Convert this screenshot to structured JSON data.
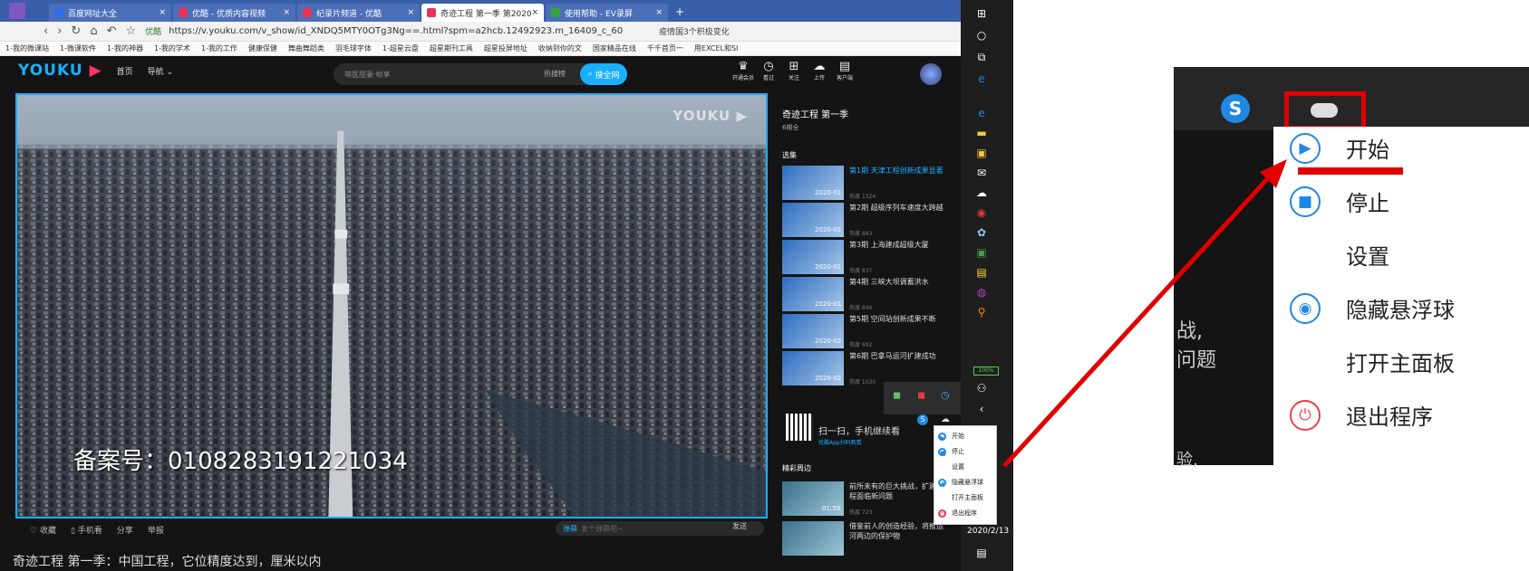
{
  "browser": {
    "tabs": [
      {
        "label": "百度网址大全",
        "color": "#2e6cf0",
        "active": false
      },
      {
        "label": "优酷 - 优质内容视频",
        "color": "#e8325a",
        "active": false
      },
      {
        "label": "纪录片频道 - 优酷",
        "color": "#e8325a",
        "active": false
      },
      {
        "label": "奇迹工程 第一季 第2020",
        "color": "#e8325a",
        "active": true
      },
      {
        "label": "使用帮助 - EV录屏",
        "color": "#37a637",
        "active": false
      }
    ],
    "new_tab": "+",
    "url": "https://v.youku.com/v_show/id_XNDQ5MTY0OTg3Ng==.html?spm=a2hcb.12492923.m_16409_c_60",
    "url_security": "优酷",
    "search_hint": "疫情国3个积极变化",
    "bookmarks": [
      "1-我的微课站",
      "1-微课软件",
      "1-我的神器",
      "1-我的学术",
      "1-我的工作",
      "健康保健",
      "舞曲舞蹈类",
      "羽毛球字体",
      "1-超星云盘",
      "超星期刊工具",
      "超星投屏地址",
      "收纳到你的文",
      "国家精品在线",
      "千千首页一",
      "用EXCEL和SI"
    ]
  },
  "youku": {
    "logo": "YOUKU",
    "nav_home": "首页",
    "nav_menu": "导航",
    "search_placeholder": "萌医甜妻·帧享",
    "hot_search": "热搜榜",
    "search_button": "搜全网",
    "header_icons": [
      {
        "label": "开通会员",
        "icon": "crown-icon",
        "glyph": "♛"
      },
      {
        "label": "看过",
        "icon": "history-icon",
        "glyph": "◷"
      },
      {
        "label": "关注",
        "icon": "follow-icon",
        "glyph": "⊞"
      },
      {
        "label": "上传",
        "icon": "upload-icon",
        "glyph": "☁"
      },
      {
        "label": "客户端",
        "icon": "client-icon",
        "glyph": "▤"
      }
    ],
    "video_watermark": "YOUKU",
    "video_caption": "备案号：0108283191221034",
    "controls": [
      "收藏",
      "手机看",
      "分享",
      "举报"
    ],
    "danmu_placeholder": "发个弹幕吧~",
    "danmu_label": "弹幕",
    "danmu_send": "发送",
    "bottom_title": "奇迹工程 第一季：中国工程，它位精度达到，厘米以内"
  },
  "right_panel": {
    "title": "奇迹工程 第一季",
    "subtitle": "6期全",
    "section": "选集",
    "episodes": [
      {
        "title": "第1期 天津工程创新成果显著",
        "date": "2020-01",
        "hot": "热度 1324",
        "active": true
      },
      {
        "title": "第2期 超级序列车速度大跨越",
        "date": "2020-01",
        "hot": "热度 883",
        "active": false
      },
      {
        "title": "第3期 上海建成超级大厦",
        "date": "2020-01",
        "hot": "热度 837",
        "active": false
      },
      {
        "title": "第4期 三峡大坝调蓄洪水",
        "date": "2020-01",
        "hot": "热度 846",
        "active": false
      },
      {
        "title": "第5期 空间站创新成果不断",
        "date": "2020-02",
        "hot": "热度 692",
        "active": false
      },
      {
        "title": "第6期 巴拿马运河扩建成功",
        "date": "2020-02",
        "hot": "热度 1030",
        "active": false
      }
    ],
    "qr_text": "扫一扫，手机继续看",
    "qr_sub": "优酷App扫码观看",
    "more_section": "精彩周边",
    "more_items": [
      {
        "title": "前所未有的巨大挑战，扩建工程面临新问题",
        "duration": "01:59",
        "hot": "热度 723"
      },
      {
        "title": "借鉴前人的创造经验，将推运河两边的保护物",
        "duration": "",
        "hot": ""
      }
    ]
  },
  "taskbar": {
    "battery": "100%",
    "date": "2020/2/13"
  },
  "context_menu": {
    "items": [
      {
        "label": "开始",
        "icon": "play-icon",
        "color": "#1e88e5",
        "glyph": "▶"
      },
      {
        "label": "停止",
        "icon": "stop-icon",
        "color": "#1e88e5",
        "glyph": "■"
      },
      {
        "label": "设置",
        "icon": "",
        "color": "",
        "glyph": ""
      },
      {
        "label": "隐藏悬浮球",
        "icon": "eye-icon",
        "color": "#1e88e5",
        "glyph": "◉"
      },
      {
        "label": "打开主面板",
        "icon": "",
        "color": "",
        "glyph": ""
      },
      {
        "label": "退出程序",
        "icon": "power-icon",
        "color": "#e8404a",
        "glyph": "⏻"
      }
    ]
  },
  "inset": {
    "side_text_1": "战,",
    "side_text_2": "问题",
    "side_text_3": "验,",
    "bottom_text": "2020/2/13"
  },
  "colors": {
    "accent": "#1aafff",
    "highlight": "#e00000",
    "youku_bg": "#141414"
  }
}
